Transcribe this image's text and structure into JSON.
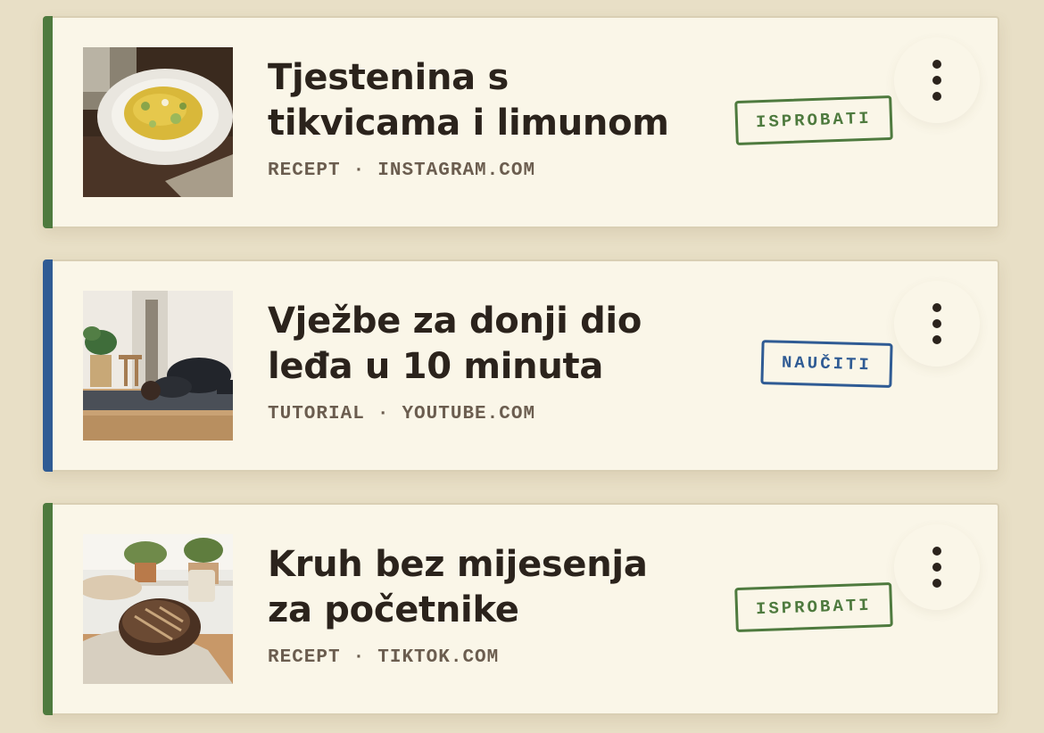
{
  "colors": {
    "background": "#e8dfc6",
    "card": "#faf6e8",
    "green": "#4e7a3e",
    "blue": "#2f5b94",
    "text": "#2b231c",
    "meta": "#6b5d4f"
  },
  "items": [
    {
      "title": "Tjestenina s tikvicama i limunom",
      "type": "RECEPT",
      "source": "INSTAGRAM.COM",
      "separator": "·",
      "action": "ISPROBATI",
      "accent": "green",
      "thumbnail": "pasta-image",
      "menu_icon": "more-vertical-icon"
    },
    {
      "title": "Vježbe za donji dio leđa u 10 minuta",
      "type": "TUTORIAL",
      "source": "YOUTUBE.COM",
      "separator": "·",
      "action": "NAUČITI",
      "accent": "blue",
      "thumbnail": "yoga-image",
      "menu_icon": "more-vertical-icon"
    },
    {
      "title": "Kruh bez mijesenja za početnike",
      "type": "RECEPT",
      "source": "TIKTOK.COM",
      "separator": "·",
      "action": "ISPROBATI",
      "accent": "green",
      "thumbnail": "bread-image",
      "menu_icon": "more-vertical-icon"
    }
  ]
}
